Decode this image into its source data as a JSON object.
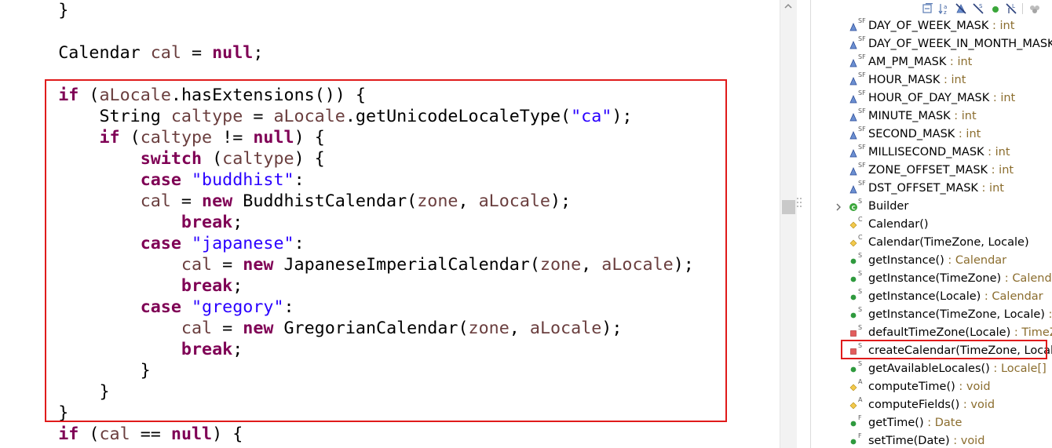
{
  "editor": {
    "lines": [
      {
        "segments": [
          {
            "t": "    }",
            "c": "pl"
          }
        ]
      },
      {
        "segments": [
          {
            "t": "",
            "c": "pl"
          }
        ]
      },
      {
        "segments": [
          {
            "t": "    Calendar ",
            "c": "pl"
          },
          {
            "t": "cal",
            "c": "fld"
          },
          {
            "t": " = ",
            "c": "pl"
          },
          {
            "t": "null",
            "c": "kw"
          },
          {
            "t": ";",
            "c": "pl"
          }
        ]
      },
      {
        "segments": [
          {
            "t": "",
            "c": "pl"
          }
        ]
      },
      {
        "segments": [
          {
            "t": "    ",
            "c": "pl"
          },
          {
            "t": "if",
            "c": "kw"
          },
          {
            "t": " (",
            "c": "pl"
          },
          {
            "t": "aLocale",
            "c": "fld"
          },
          {
            "t": ".hasExtensions()) {",
            "c": "pl"
          }
        ]
      },
      {
        "segments": [
          {
            "t": "        String ",
            "c": "pl"
          },
          {
            "t": "caltype",
            "c": "fld"
          },
          {
            "t": " = ",
            "c": "pl"
          },
          {
            "t": "aLocale",
            "c": "fld"
          },
          {
            "t": ".getUnicodeLocaleType(",
            "c": "pl"
          },
          {
            "t": "\"ca\"",
            "c": "str"
          },
          {
            "t": ");",
            "c": "pl"
          }
        ]
      },
      {
        "segments": [
          {
            "t": "        ",
            "c": "pl"
          },
          {
            "t": "if",
            "c": "kw"
          },
          {
            "t": " (",
            "c": "pl"
          },
          {
            "t": "caltype",
            "c": "fld"
          },
          {
            "t": " != ",
            "c": "pl"
          },
          {
            "t": "null",
            "c": "kw"
          },
          {
            "t": ") {",
            "c": "pl"
          }
        ]
      },
      {
        "segments": [
          {
            "t": "            ",
            "c": "pl"
          },
          {
            "t": "switch",
            "c": "kw"
          },
          {
            "t": " (",
            "c": "pl"
          },
          {
            "t": "caltype",
            "c": "fld"
          },
          {
            "t": ") {",
            "c": "pl"
          }
        ]
      },
      {
        "segments": [
          {
            "t": "            ",
            "c": "pl"
          },
          {
            "t": "case",
            "c": "kw"
          },
          {
            "t": " ",
            "c": "pl"
          },
          {
            "t": "\"buddhist\"",
            "c": "str"
          },
          {
            "t": ":",
            "c": "pl"
          }
        ]
      },
      {
        "segments": [
          {
            "t": "            ",
            "c": "pl"
          },
          {
            "t": "cal",
            "c": "fld"
          },
          {
            "t": " = ",
            "c": "pl"
          },
          {
            "t": "new",
            "c": "kw"
          },
          {
            "t": " BuddhistCalendar(",
            "c": "pl"
          },
          {
            "t": "zone",
            "c": "fld"
          },
          {
            "t": ", ",
            "c": "pl"
          },
          {
            "t": "aLocale",
            "c": "fld"
          },
          {
            "t": ");",
            "c": "pl"
          }
        ]
      },
      {
        "segments": [
          {
            "t": "                ",
            "c": "pl"
          },
          {
            "t": "break",
            "c": "kw"
          },
          {
            "t": ";",
            "c": "pl"
          }
        ]
      },
      {
        "segments": [
          {
            "t": "            ",
            "c": "pl"
          },
          {
            "t": "case",
            "c": "kw"
          },
          {
            "t": " ",
            "c": "pl"
          },
          {
            "t": "\"japanese\"",
            "c": "str"
          },
          {
            "t": ":",
            "c": "pl"
          }
        ]
      },
      {
        "segments": [
          {
            "t": "                ",
            "c": "pl"
          },
          {
            "t": "cal",
            "c": "fld"
          },
          {
            "t": " = ",
            "c": "pl"
          },
          {
            "t": "new",
            "c": "kw"
          },
          {
            "t": " JapaneseImperialCalendar(",
            "c": "pl"
          },
          {
            "t": "zone",
            "c": "fld"
          },
          {
            "t": ", ",
            "c": "pl"
          },
          {
            "t": "aLocale",
            "c": "fld"
          },
          {
            "t": ");",
            "c": "pl"
          }
        ]
      },
      {
        "segments": [
          {
            "t": "                ",
            "c": "pl"
          },
          {
            "t": "break",
            "c": "kw"
          },
          {
            "t": ";",
            "c": "pl"
          }
        ]
      },
      {
        "segments": [
          {
            "t": "            ",
            "c": "pl"
          },
          {
            "t": "case",
            "c": "kw"
          },
          {
            "t": " ",
            "c": "pl"
          },
          {
            "t": "\"gregory\"",
            "c": "str"
          },
          {
            "t": ":",
            "c": "pl"
          }
        ]
      },
      {
        "segments": [
          {
            "t": "                ",
            "c": "pl"
          },
          {
            "t": "cal",
            "c": "fld"
          },
          {
            "t": " = ",
            "c": "pl"
          },
          {
            "t": "new",
            "c": "kw"
          },
          {
            "t": " GregorianCalendar(",
            "c": "pl"
          },
          {
            "t": "zone",
            "c": "fld"
          },
          {
            "t": ", ",
            "c": "pl"
          },
          {
            "t": "aLocale",
            "c": "fld"
          },
          {
            "t": ");",
            "c": "pl"
          }
        ]
      },
      {
        "segments": [
          {
            "t": "                ",
            "c": "pl"
          },
          {
            "t": "break",
            "c": "kw"
          },
          {
            "t": ";",
            "c": "pl"
          }
        ]
      },
      {
        "segments": [
          {
            "t": "            }",
            "c": "pl"
          }
        ]
      },
      {
        "segments": [
          {
            "t": "        }",
            "c": "pl"
          }
        ]
      },
      {
        "segments": [
          {
            "t": "    }",
            "c": "pl"
          }
        ]
      },
      {
        "segments": [
          {
            "t": "    ",
            "c": "pl"
          },
          {
            "t": "if",
            "c": "kw"
          },
          {
            "t": " (",
            "c": "pl"
          },
          {
            "t": "cal",
            "c": "fld"
          },
          {
            "t": " == ",
            "c": "pl"
          },
          {
            "t": "null",
            "c": "kw"
          },
          {
            "t": ") {",
            "c": "pl"
          }
        ]
      }
    ]
  },
  "outline": {
    "toolbar_icons": [
      "collapse-all-icon",
      "sort-alphabetical-icon",
      "hide-fields-icon",
      "hide-static-icon",
      "hide-non-public-icon",
      "hide-local-types-icon",
      "link-with-editor-icon"
    ],
    "items": [
      {
        "kind": "field",
        "name": "DAY_OF_WEEK_MASK",
        "sep": " : ",
        "type": "int",
        "mod": "SF"
      },
      {
        "kind": "field",
        "name": "DAY_OF_WEEK_IN_MONTH_MASK",
        "sep": "",
        "type": "",
        "mod": "SF"
      },
      {
        "kind": "field",
        "name": "AM_PM_MASK",
        "sep": " : ",
        "type": "int",
        "mod": "SF"
      },
      {
        "kind": "field",
        "name": "HOUR_MASK",
        "sep": " : ",
        "type": "int",
        "mod": "SF"
      },
      {
        "kind": "field",
        "name": "HOUR_OF_DAY_MASK",
        "sep": " : ",
        "type": "int",
        "mod": "SF"
      },
      {
        "kind": "field",
        "name": "MINUTE_MASK",
        "sep": " : ",
        "type": "int",
        "mod": "SF"
      },
      {
        "kind": "field",
        "name": "SECOND_MASK",
        "sep": " : ",
        "type": "int",
        "mod": "SF"
      },
      {
        "kind": "field",
        "name": "MILLISECOND_MASK",
        "sep": " : ",
        "type": "int",
        "mod": "SF"
      },
      {
        "kind": "field",
        "name": "ZONE_OFFSET_MASK",
        "sep": " : ",
        "type": "int",
        "mod": "SF"
      },
      {
        "kind": "field",
        "name": "DST_OFFSET_MASK",
        "sep": " : ",
        "type": "int",
        "mod": "SF"
      },
      {
        "kind": "class",
        "name": "Builder",
        "sep": "",
        "type": "",
        "mod": "S"
      },
      {
        "kind": "protected",
        "name": "Calendar()",
        "sep": "",
        "type": "",
        "mod": "C"
      },
      {
        "kind": "protected",
        "name": "Calendar(TimeZone, Locale)",
        "sep": "",
        "type": "",
        "mod": "C"
      },
      {
        "kind": "public",
        "name": "getInstance()",
        "sep": " : ",
        "type": "Calendar",
        "mod": "S"
      },
      {
        "kind": "public",
        "name": "getInstance(TimeZone)",
        "sep": " : ",
        "type": "Calendar",
        "mod": "S"
      },
      {
        "kind": "public",
        "name": "getInstance(Locale)",
        "sep": " : ",
        "type": "Calendar",
        "mod": "S"
      },
      {
        "kind": "public",
        "name": "getInstance(TimeZone, Locale)",
        "sep": " : ",
        "type": "",
        "mod": "S"
      },
      {
        "kind": "private",
        "name": "defaultTimeZone(Locale)",
        "sep": " : ",
        "type": "TimeZ",
        "mod": "S"
      },
      {
        "kind": "private",
        "name": "createCalendar(TimeZone, Locale",
        "sep": "",
        "type": "",
        "mod": "S"
      },
      {
        "kind": "public-sync",
        "name": "getAvailableLocales()",
        "sep": " : ",
        "type": "Locale[]",
        "mod": "S"
      },
      {
        "kind": "protected",
        "name": "computeTime()",
        "sep": " : ",
        "type": "void",
        "mod": "A"
      },
      {
        "kind": "protected",
        "name": "computeFields()",
        "sep": " : ",
        "type": "void",
        "mod": "A"
      },
      {
        "kind": "public",
        "name": "getTime()",
        "sep": " : ",
        "type": "Date",
        "mod": "F"
      },
      {
        "kind": "public",
        "name": "setTime(Date)",
        "sep": " : ",
        "type": "void",
        "mod": "F"
      }
    ]
  },
  "colors": {
    "keyword": "#7f0055",
    "field": "#6a3e3e",
    "string": "#2a00ff",
    "type_suffix": "#8b6d2e",
    "highlight_border": "#e01b1b"
  }
}
